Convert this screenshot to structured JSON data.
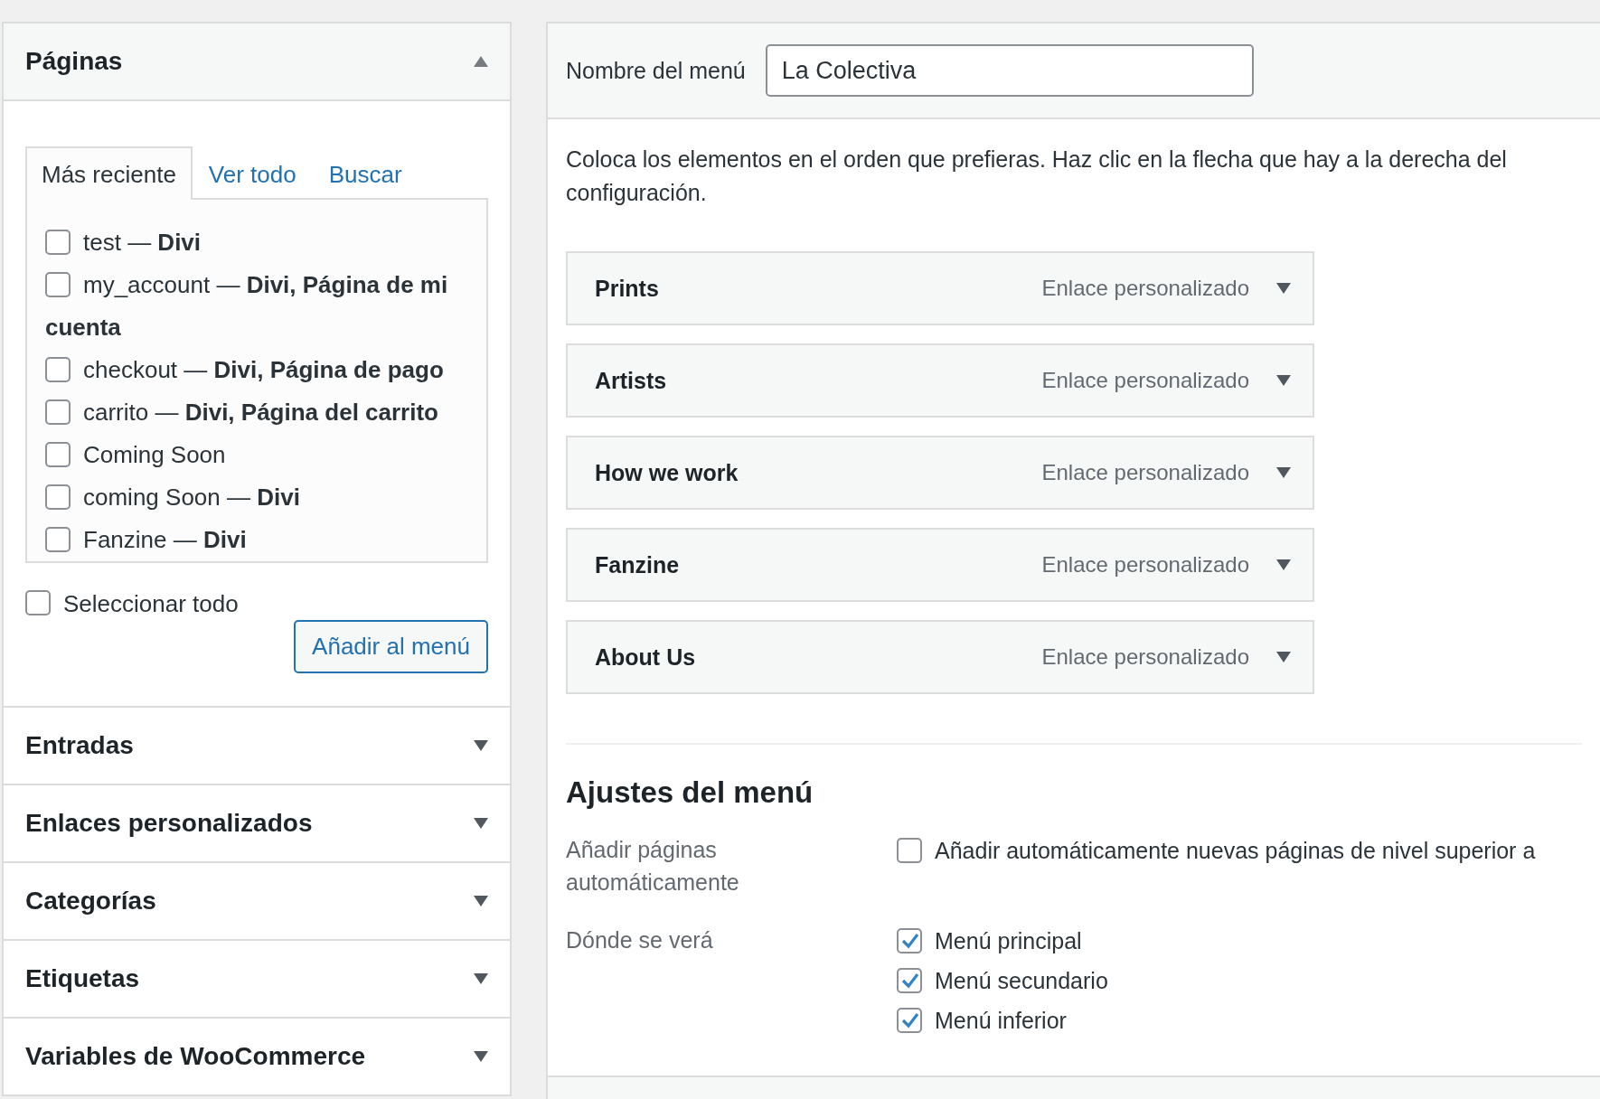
{
  "left_sections": [
    {
      "title": "Páginas",
      "expanded": true,
      "tabs": [
        {
          "label": "Más reciente",
          "selected": true
        },
        {
          "label": "Ver todo",
          "selected": false
        },
        {
          "label": "Buscar",
          "selected": false
        }
      ],
      "items": [
        {
          "label": "test — **Divi**",
          "checked": false
        },
        {
          "label": "my_account — **Divi, Página de mi cuenta**",
          "checked": false
        },
        {
          "label": "checkout — **Divi, Página de pago**",
          "checked": false
        },
        {
          "label": "carrito — **Divi, Página del carrito**",
          "checked": false
        },
        {
          "label": "Coming Soon",
          "checked": false
        },
        {
          "label": "coming Soon — **Divi**",
          "checked": false
        },
        {
          "label": "Fanzine — **Divi**",
          "checked": false
        }
      ],
      "select_all": {
        "label": "Seleccionar todo",
        "checked": false
      },
      "button": "Añadir al menú"
    },
    {
      "title": "Entradas",
      "expanded": false
    },
    {
      "title": "Enlaces personalizados",
      "expanded": false
    },
    {
      "title": "Categorías",
      "expanded": false
    },
    {
      "title": "Etiquetas",
      "expanded": false
    },
    {
      "title": "Variables de WooCommerce",
      "expanded": false
    }
  ],
  "menu_name": {
    "label": "Nombre del menú",
    "value": "La Colectiva"
  },
  "instructions": [
    "Coloca los elementos en el orden que prefieras. Haz clic en la flecha que hay a la derecha del",
    "configuración."
  ],
  "menu_items": [
    {
      "title": "Prints",
      "type": "Enlace personalizado"
    },
    {
      "title": "Artists",
      "type": "Enlace personalizado"
    },
    {
      "title": "How we work",
      "type": "Enlace personalizado"
    },
    {
      "title": "Fanzine",
      "type": "Enlace personalizado"
    },
    {
      "title": "About Us",
      "type": "Enlace personalizado"
    }
  ],
  "settings": {
    "heading": "Ajustes del menú",
    "rows": [
      {
        "label": "Añadir páginas automáticamente",
        "options": [
          {
            "label": "Añadir automáticamente nuevas páginas de nivel superior a",
            "checked": false
          }
        ]
      },
      {
        "label": "Dónde se verá",
        "options": [
          {
            "label": "Menú principal",
            "checked": true
          },
          {
            "label": "Menú secundario",
            "checked": true
          },
          {
            "label": "Menú inferior",
            "checked": true
          }
        ]
      }
    ]
  }
}
